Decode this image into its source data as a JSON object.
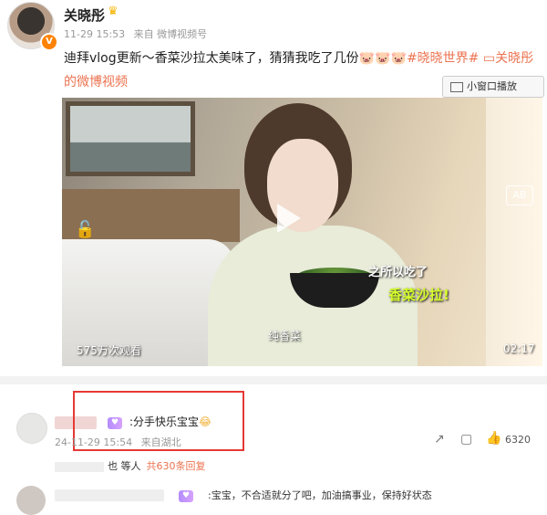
{
  "post": {
    "username": "关晓彤",
    "meta": {
      "time": "11-29 15:53",
      "source": "来自 微博视频号"
    },
    "text_main": "迪拜vlog更新～香菜沙拉太美味了，猜猜我吃了几份",
    "emoji": "🐷🐷🐷",
    "hashtag": "#晓晓世界#",
    "link": "关晓彤的微博视频",
    "mini_window_label": "小窗口播放"
  },
  "video": {
    "subtitle_line1": "之所以吃了",
    "subtitle_line2": "香菜沙拉!",
    "caption": "纯香菜",
    "views": "575万次观看",
    "duration": "02:17",
    "ab_label": "AB"
  },
  "comment1": {
    "text": ":分手快乐宝宝",
    "emoji": "😂",
    "time": "24-11-29 15:54",
    "location": "来自湖北",
    "like_count": "6320",
    "replies_prefix": "也 等人",
    "replies_link": "共630条回复"
  },
  "comment2": {
    "text": ":宝宝，不合适就分了吧，加油搞事业，保持好状态"
  },
  "colors": {
    "accent": "#eb7350",
    "vip": "#ff8200",
    "highlight_box": "#e53935"
  }
}
